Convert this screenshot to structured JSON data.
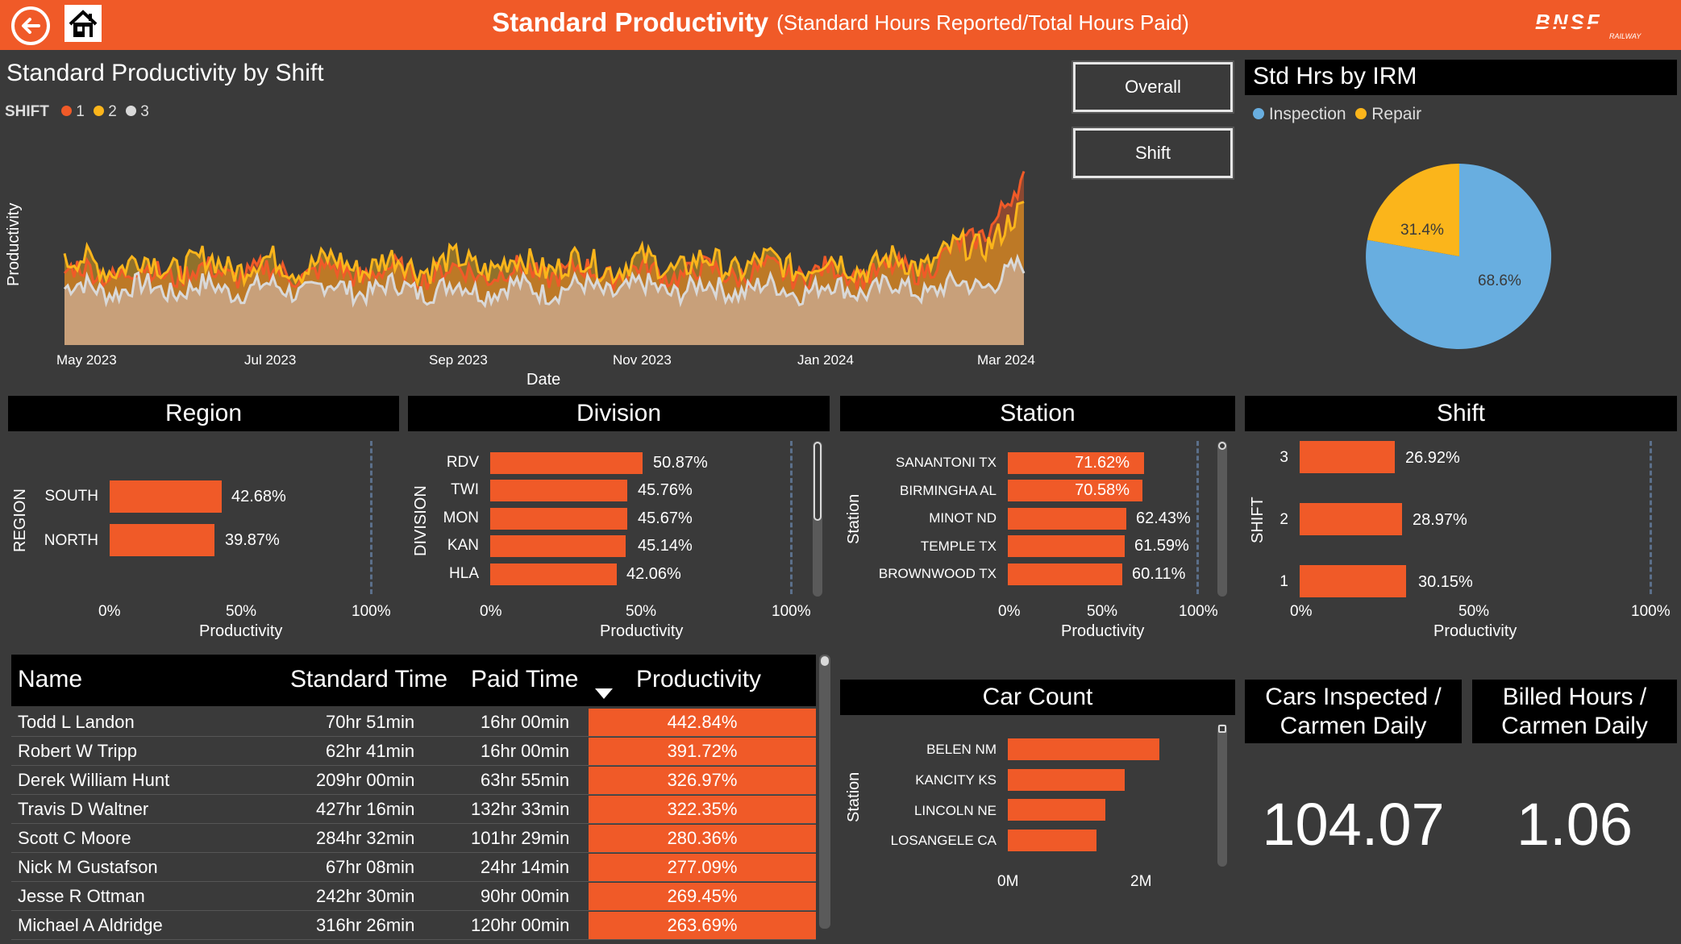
{
  "header": {
    "title": "Standard Productivity",
    "subtitle": "(Standard Hours Reported/Total Hours Paid)",
    "logo_text": "BNSF",
    "logo_subtext": "RAILWAY",
    "back_icon": "back-arrow-icon",
    "home_icon": "home-icon"
  },
  "colors": {
    "accent": "#f05a28",
    "shift1": "#f05a28",
    "shift2": "#fbb51b",
    "shift3": "#d9d9d9",
    "inspection": "#68aee0",
    "repair": "#fbb51b",
    "background": "#3a3a3a"
  },
  "line_chart": {
    "title": "Standard Productivity by Shift",
    "legend_title": "SHIFT",
    "legend": [
      "1",
      "2",
      "3"
    ],
    "ylabel": "Productivity",
    "xlabel": "Date",
    "x_ticks": [
      "May 2023",
      "Jul 2023",
      "Sep 2023",
      "Nov 2023",
      "Jan 2024",
      "Mar 2024"
    ]
  },
  "buttons": {
    "overall": "Overall",
    "shift": "Shift"
  },
  "pie": {
    "title": "Std Hrs by IRM",
    "legend": [
      "Inspection",
      "Repair"
    ],
    "labels": [
      "68.6%",
      "31.4%"
    ]
  },
  "region": {
    "title": "Region",
    "axis_title": "REGION",
    "xlabel": "Productivity",
    "ticks": [
      "0%",
      "50%",
      "100%"
    ],
    "rows": [
      {
        "label": "SOUTH",
        "value_text": "42.68%"
      },
      {
        "label": "NORTH",
        "value_text": "39.87%"
      }
    ]
  },
  "division": {
    "title": "Division",
    "axis_title": "DIVISION",
    "xlabel": "Productivity",
    "ticks": [
      "0%",
      "50%",
      "100%"
    ],
    "rows": [
      {
        "label": "RDV",
        "value_text": "50.87%"
      },
      {
        "label": "TWI",
        "value_text": "45.76%"
      },
      {
        "label": "MON",
        "value_text": "45.67%"
      },
      {
        "label": "KAN",
        "value_text": "45.14%"
      },
      {
        "label": "HLA",
        "value_text": "42.06%"
      }
    ]
  },
  "station": {
    "title": "Station",
    "axis_title": "Station",
    "xlabel": "Productivity",
    "ticks": [
      "0%",
      "50%",
      "100%"
    ],
    "rows": [
      {
        "label": "SANANTONI TX",
        "value_text": "71.62%"
      },
      {
        "label": "BIRMINGHA AL",
        "value_text": "70.58%"
      },
      {
        "label": "MINOT ND",
        "value_text": "62.43%"
      },
      {
        "label": "TEMPLE TX",
        "value_text": "61.59%"
      },
      {
        "label": "BROWNWOOD TX",
        "value_text": "60.11%"
      }
    ]
  },
  "shift_chart": {
    "title": "Shift",
    "axis_title": "SHIFT",
    "xlabel": "Productivity",
    "ticks": [
      "0%",
      "50%",
      "100%"
    ],
    "rows": [
      {
        "label": "3",
        "value_text": "26.92%"
      },
      {
        "label": "2",
        "value_text": "28.97%"
      },
      {
        "label": "1",
        "value_text": "30.15%"
      }
    ]
  },
  "table": {
    "columns": [
      "Name",
      "Standard Time",
      "Paid Time",
      "Productivity"
    ],
    "sort_icon": "sort-descending-icon",
    "rows": [
      {
        "name": "Todd L Landon",
        "standard": "70hr 51min",
        "paid": "16hr 00min",
        "productivity": "442.84%"
      },
      {
        "name": "Robert W Tripp",
        "standard": "62hr 41min",
        "paid": "16hr 00min",
        "productivity": "391.72%"
      },
      {
        "name": "Derek William Hunt",
        "standard": "209hr 00min",
        "paid": "63hr 55min",
        "productivity": "326.97%"
      },
      {
        "name": "Travis D Waltner",
        "standard": "427hr 16min",
        "paid": "132hr 33min",
        "productivity": "322.35%"
      },
      {
        "name": "Scott C Moore",
        "standard": "284hr 32min",
        "paid": "101hr 29min",
        "productivity": "280.36%"
      },
      {
        "name": "Nick M Gustafson",
        "standard": "67hr 08min",
        "paid": "24hr 14min",
        "productivity": "277.09%"
      },
      {
        "name": "Jesse R Ottman",
        "standard": "242hr 30min",
        "paid": "90hr 00min",
        "productivity": "269.45%"
      },
      {
        "name": "Michael A Aldridge",
        "standard": "316hr 26min",
        "paid": "120hr 00min",
        "productivity": "263.69%"
      }
    ]
  },
  "car_count": {
    "title": "Car Count",
    "axis_title": "Station",
    "ticks": [
      "0M",
      "2M"
    ],
    "rows": [
      "BELEN NM",
      "KANCITY KS",
      "LINCOLN NE",
      "LOSANGELE CA"
    ]
  },
  "kpis": {
    "cars_inspected_title": "Cars Inspected / Carmen Daily",
    "cars_inspected_value": "104.07",
    "billed_hours_title": "Billed Hours / Carmen Daily",
    "billed_hours_value": "1.06"
  }
}
